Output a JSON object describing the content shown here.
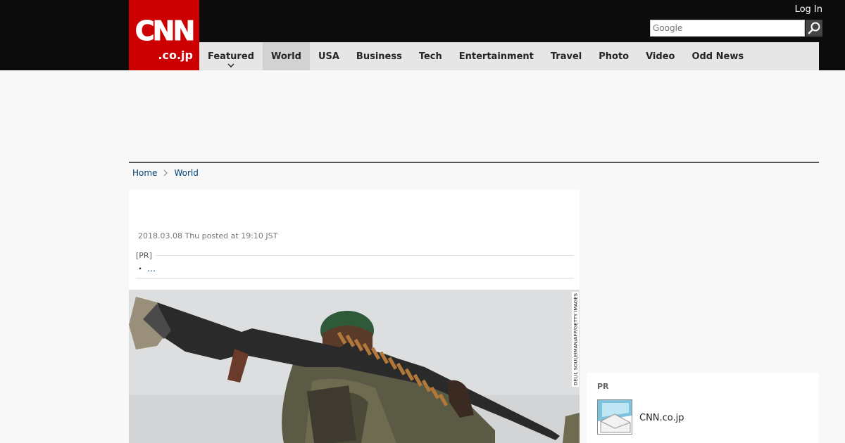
{
  "header": {
    "logo_main": "CNN",
    "logo_sub": ".co.jp",
    "login_label": "Log In",
    "search_placeholder": "Google"
  },
  "nav": {
    "items": [
      {
        "label": "Featured",
        "active": false,
        "has_dropdown": true
      },
      {
        "label": "World",
        "active": true
      },
      {
        "label": "USA"
      },
      {
        "label": "Business"
      },
      {
        "label": "Tech"
      },
      {
        "label": "Entertainment"
      },
      {
        "label": "Travel"
      },
      {
        "label": "Photo"
      },
      {
        "label": "Video"
      },
      {
        "label": "Odd News"
      }
    ]
  },
  "breadcrumb": {
    "home": "Home",
    "current": "World"
  },
  "article": {
    "date": "2018.03.08 Thu posted at 19:10 JST",
    "pr_label": "[PR]",
    "pr_bullet": "・",
    "pr_link": "…",
    "photo_credit": "DELIL SOULEIMAN/AFP/GETTY IMAGES"
  },
  "sidebar": {
    "pr_label": "PR",
    "item_label": "CNN.co.jp"
  },
  "colors": {
    "brand_red": "#cc0000",
    "topbar": "#0c0c0c",
    "nav_bg": "#e6e6e6",
    "link": "#004276"
  }
}
